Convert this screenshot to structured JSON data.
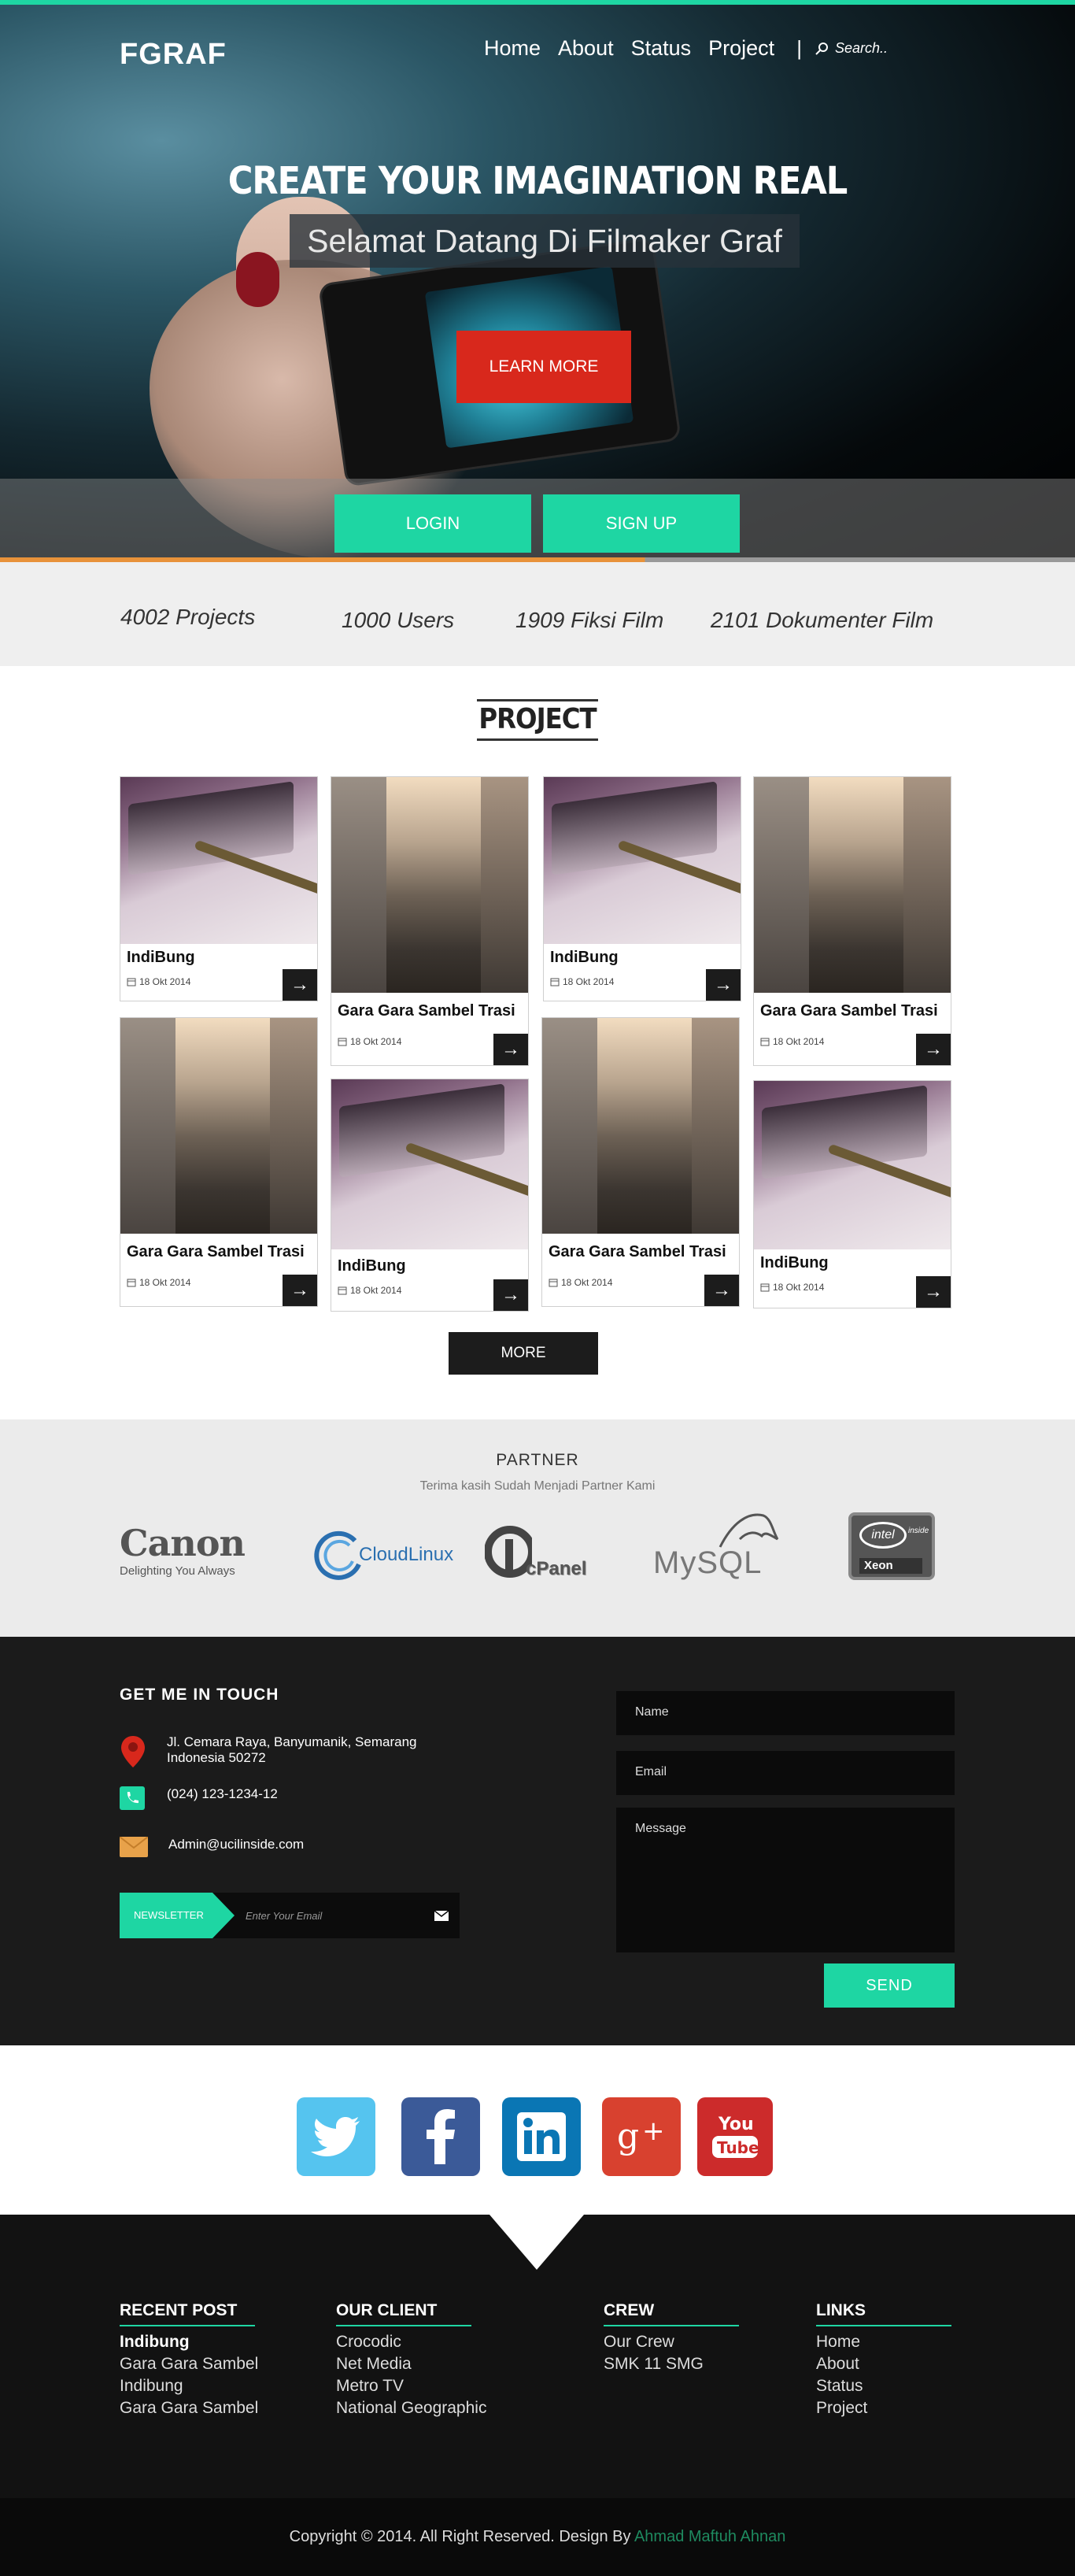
{
  "header": {
    "logo": "FGRAF",
    "nav": [
      "Home",
      "About",
      "Status",
      "Project"
    ],
    "separator": "|",
    "search_placeholder": "Search.."
  },
  "hero": {
    "title": "CREATE YOUR IMAGINATION REAL",
    "subtitle": "Selamat Datang Di Filmaker Graf",
    "learn_more": "LEARN MORE",
    "login": "LOGIN",
    "signup": "SIGN UP"
  },
  "stats": [
    "4002 Projects",
    "1000 Users",
    "1909 Fiksi Film",
    "2101 Dokumenter Film"
  ],
  "projects": {
    "title": "PROJECT",
    "cards": [
      {
        "title": "IndiBung",
        "date": "18 Okt 2014"
      },
      {
        "title": "Gara Gara Sambel Trasi",
        "date": "18 Okt 2014"
      },
      {
        "title": "IndiBung",
        "date": "18 Okt 2014"
      },
      {
        "title": "Gara Gara Sambel Trasi",
        "date": "18 Okt 2014"
      },
      {
        "title": "Gara Gara Sambel Trasi",
        "date": "18 Okt 2014"
      },
      {
        "title": "IndiBung",
        "date": "18 Okt 2014"
      },
      {
        "title": "Gara Gara Sambel Trasi",
        "date": "18 Okt 2014"
      },
      {
        "title": "IndiBung",
        "date": "18 Okt 2014"
      }
    ],
    "arrow": "→",
    "more": "MORE"
  },
  "partners": {
    "title": "PARTNER",
    "subtitle": "Terima kasih Sudah Menjadi Partner Kami",
    "logos": [
      {
        "name": "Canon",
        "tagline": "Delighting You Always"
      },
      {
        "name": "CloudLinux"
      },
      {
        "name": "cPanel"
      },
      {
        "name": "MySQL"
      },
      {
        "name": "intel",
        "tagline": "inside",
        "sub": "Xeon"
      }
    ]
  },
  "contact": {
    "title": "GET ME IN TOUCH",
    "address": [
      "Jl. Cemara Raya, Banyumanik, Semarang",
      "Indonesia 50272"
    ],
    "phone": "(024) 123-1234-12",
    "email": "Admin@ucilinside.com",
    "newsletter_label": "NEWSLETTER",
    "newsletter_placeholder": "Enter Your Email",
    "form": {
      "name": "Name",
      "email": "Email",
      "message": "Message",
      "send": "SEND"
    }
  },
  "social": [
    "twitter",
    "facebook",
    "linkedin",
    "google-plus",
    "youtube"
  ],
  "social_colors": {
    "twitter": "#55c4ef",
    "facebook": "#3b5a98",
    "linkedin": "#0a76b4",
    "google-plus": "#d8412f",
    "youtube": "#cc2b2b"
  },
  "footer": {
    "columns": [
      {
        "title": "RECENT POST",
        "items": [
          "Indibung",
          "Gara Gara Sambel",
          "Indibung",
          "Gara Gara Sambel"
        ]
      },
      {
        "title": "OUR CLIENT",
        "items": [
          "Crocodic",
          "Net Media",
          "Metro TV",
          "National Geographic"
        ]
      },
      {
        "title": "CREW",
        "items": [
          "Our Crew",
          "SMK 11 SMG"
        ]
      },
      {
        "title": "LINKS",
        "items": [
          "Home",
          "About",
          "Status",
          "Project"
        ]
      }
    ],
    "copyright": "Copyright © 2014. All Right Reserved. Design By",
    "author": "Ahmad Maftuh Ahnan"
  },
  "colors": {
    "accent": "#1ed6a3",
    "danger": "#d8281c",
    "dark": "#1b1b1b"
  }
}
